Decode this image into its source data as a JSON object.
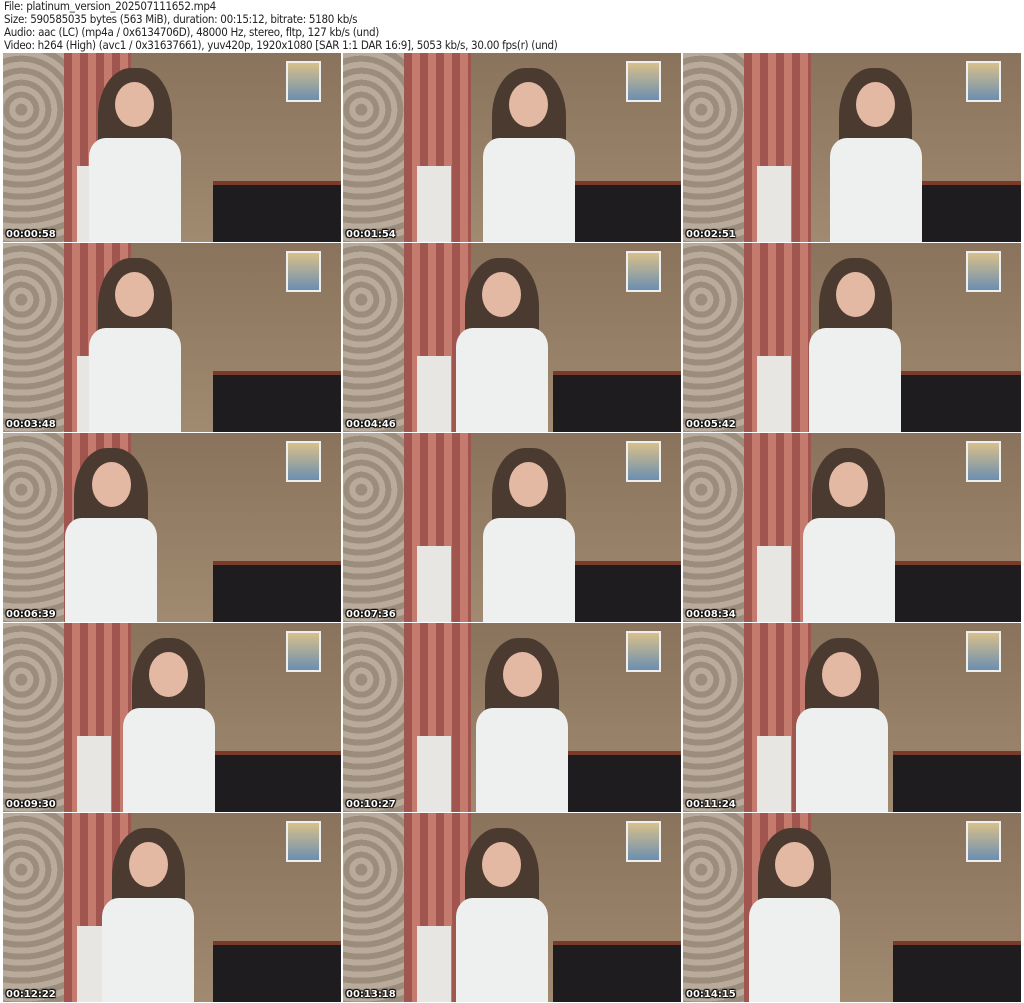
{
  "header": {
    "file": "File: platinum_version_202507111652.mp4",
    "size": "Size: 590585035 bytes (563 MiB), duration: 00:15:12, bitrate: 5180 kb/s",
    "audio": "Audio: aac (LC) (mp4a / 0x6134706D), 48000 Hz, stereo, fltp, 127 kb/s (und)",
    "video": "Video: h264 (High) (avc1 / 0x31637661), yuv420p, 1920x1080 [SAR 1:1 DAR 16:9], 5053 kb/s, 30.00 fps(r) (und)"
  },
  "thumbnails": [
    {
      "time": "00:00:58"
    },
    {
      "time": "00:01:54"
    },
    {
      "time": "00:02:51"
    },
    {
      "time": "00:03:48"
    },
    {
      "time": "00:04:46"
    },
    {
      "time": "00:05:42"
    },
    {
      "time": "00:06:39"
    },
    {
      "time": "00:07:36"
    },
    {
      "time": "00:08:34"
    },
    {
      "time": "00:09:30"
    },
    {
      "time": "00:10:27"
    },
    {
      "time": "00:11:24"
    },
    {
      "time": "00:12:22"
    },
    {
      "time": "00:13:18"
    },
    {
      "time": "00:14:15"
    }
  ]
}
